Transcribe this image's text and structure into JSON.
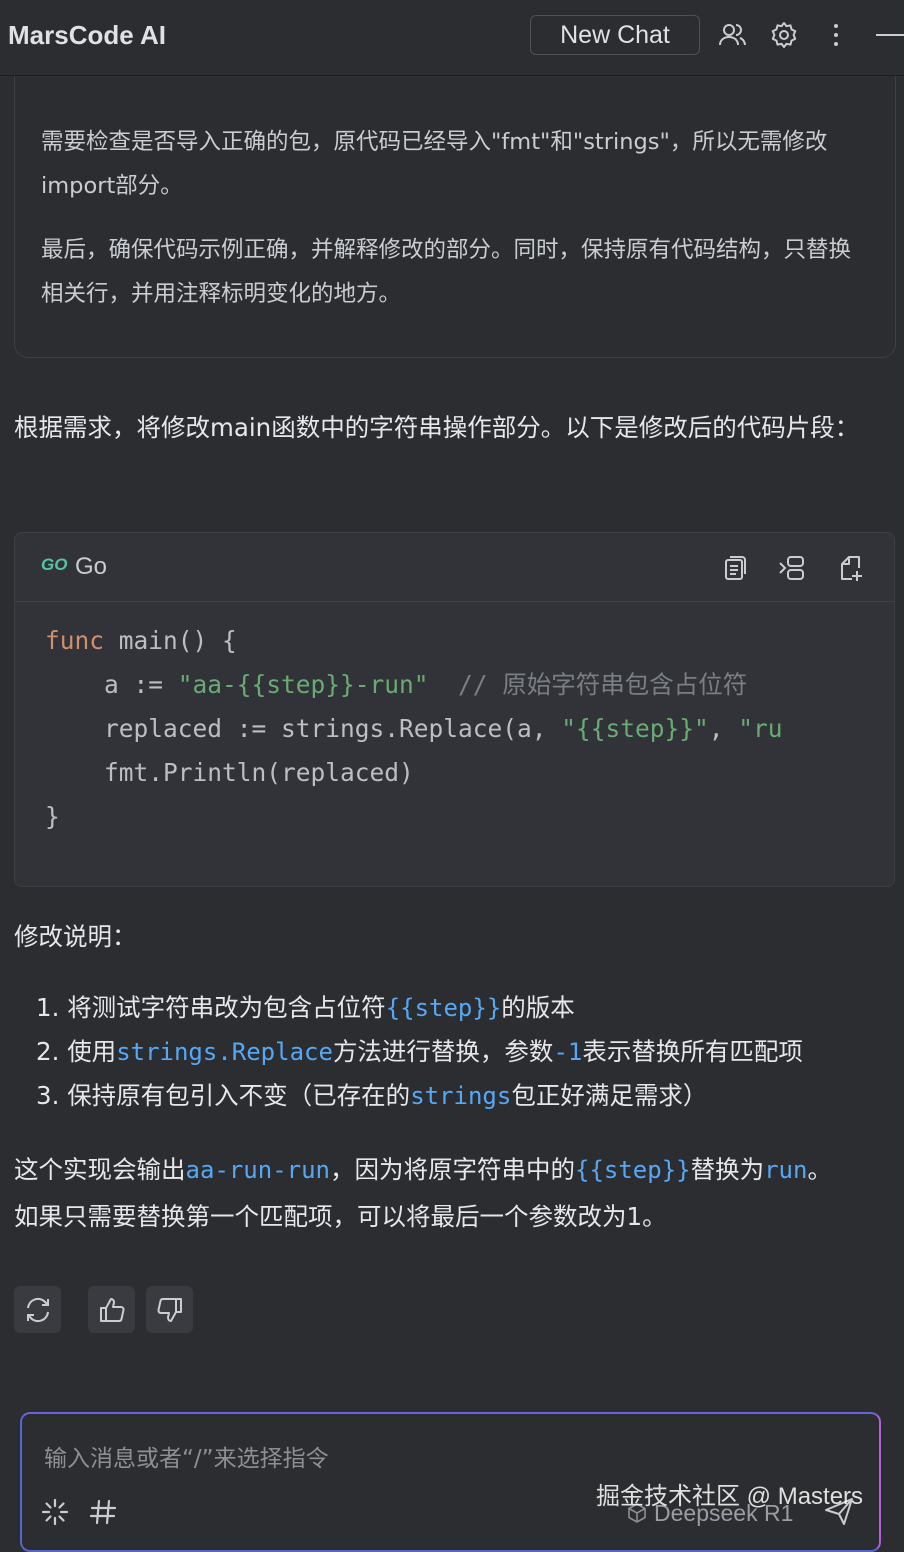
{
  "header": {
    "title": "MarsCode AI",
    "new_chat_label": "New Chat"
  },
  "reasoning": {
    "paragraph_1": "需要检查是否导入正确的包，原代码已经导入\"fmt\"和\"strings\"，所以无需修改import部分。",
    "paragraph_2": "最后，确保代码示例正确，并解释修改的部分。同时，保持原有代码结构，只替换相关行，并用注释标明变化的地方。"
  },
  "answer": {
    "intro": "根据需求，将修改main函数中的字符串操作部分。以下是修改后的代码片段：",
    "code_language": "Go",
    "code": {
      "line1_kw": "func",
      "line1_rest": " main() {",
      "line2_a": "    a := ",
      "line2_str": "\"aa-{{step}}-run\"",
      "line2_gap": "  ",
      "line2_comment": "// 原始字符串包含占位符",
      "line3_a": "    replaced := strings.Replace(a, ",
      "line3_str1": "\"{{step}}\"",
      "line3_comma": ", ",
      "line3_str2": "\"ru",
      "line4": "    fmt.Println(replaced)",
      "line5": "}"
    },
    "explain_title": "修改说明：",
    "items": [
      {
        "num": "1.",
        "t1": "将测试字符串改为包含占位符",
        "c1": "{{step}}",
        "t2": "的版本",
        "c2": "",
        "t3": ""
      },
      {
        "num": "2.",
        "t1": "使用",
        "c1": "strings.Replace",
        "t2": "方法进行替换，参数",
        "c2": "-1",
        "t3": "表示替换所有匹配项"
      },
      {
        "num": "3.",
        "t1": "保持原有包引入不变（已存在的",
        "c1": "strings",
        "t2": "包正好满足需求）",
        "c2": "",
        "t3": ""
      }
    ],
    "summary_t1": "这个实现会输出",
    "summary_c1": "aa-run-run",
    "summary_t2": "，因为将原字符串中的",
    "summary_c2": "{{step}}",
    "summary_t3": "替换为",
    "summary_c3": "run",
    "summary_t4": "。",
    "summary_line2": "如果只需要替换第一个匹配项，可以将最后一个参数改为1。"
  },
  "input": {
    "placeholder": "输入消息或者“/”来选择指令",
    "model": "Deepseek R1"
  },
  "watermark": "掘金技术社区 @ Masters",
  "colors": {
    "background": "#2b2d30",
    "keyword": "#cf8e6d",
    "string": "#6aab73",
    "comment": "#7a7e85",
    "inline_code": "#56a8f5",
    "input_border_gradient": [
      "#5865d0",
      "#b05fd8"
    ]
  }
}
